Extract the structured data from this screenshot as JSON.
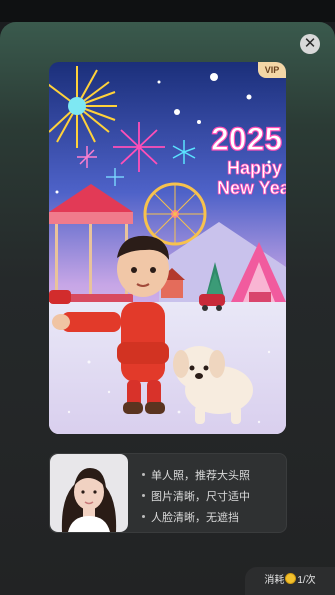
{
  "preview": {
    "badge": "VIP",
    "overlay_year": "2025",
    "overlay_greeting_1": "Happy",
    "overlay_greeting_2": "New Year"
  },
  "tips": {
    "items": [
      "单人照，推荐大头照",
      "图片清晰，尺寸适中",
      "人脸清晰，无遮挡"
    ]
  },
  "cost": {
    "prefix": "消耗",
    "suffix": "1/次"
  }
}
